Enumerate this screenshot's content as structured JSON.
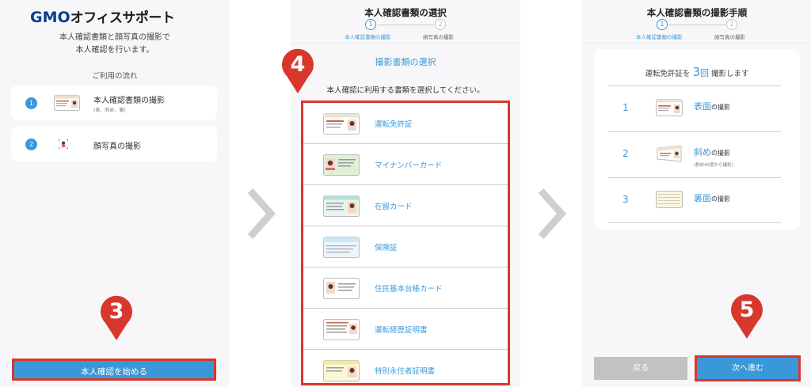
{
  "colors": {
    "accent": "#3a98d8",
    "highlight": "#d8372c",
    "panel_bg": "#f7f7f9",
    "disabled": "#c2c2c2"
  },
  "panel1": {
    "logo_gmo": "GMO",
    "logo_text": "オフィスサポート",
    "intro_line1": "本人確認書類と顔写真の撮影で",
    "intro_line2": "本人確認を行います。",
    "flow_title": "ご利用の流れ",
    "flow": [
      {
        "num": "1",
        "label": "本人確認書類の撮影",
        "sub": "(表、斜め、裏)",
        "icon": "id-card-icon"
      },
      {
        "num": "2",
        "label": "顔写真の撮影",
        "icon": "face-scan-icon"
      }
    ],
    "start_button": "本人確認を始める",
    "marker": "3"
  },
  "panel2": {
    "title": "本人確認書類の選択",
    "steps": [
      {
        "num": "1",
        "label": "本人確認書類の撮影",
        "active": true
      },
      {
        "num": "2",
        "label": "顔写真の撮影",
        "active": false
      }
    ],
    "section_title": "撮影書類の選択",
    "instruction": "本人確認に利用する書類を選択してください。",
    "documents": [
      {
        "label": "運転免許証",
        "icon": "drivers-license-icon"
      },
      {
        "label": "マイナンバーカード",
        "icon": "my-number-card-icon"
      },
      {
        "label": "在留カード",
        "icon": "residence-card-icon"
      },
      {
        "label": "保険証",
        "icon": "insurance-card-icon"
      },
      {
        "label": "住民基本台帳カード",
        "icon": "resident-registry-card-icon"
      },
      {
        "label": "運転経歴証明書",
        "icon": "driving-history-certificate-icon"
      },
      {
        "label": "特別永住者証明書",
        "icon": "special-permanent-resident-icon"
      }
    ],
    "marker": "4"
  },
  "panel3": {
    "title": "本人確認書類の撮影手順",
    "steps": [
      {
        "num": "1",
        "label": "本人確認書類の撮影",
        "active": true
      },
      {
        "num": "2",
        "label": "顔写真の撮影",
        "active": false
      }
    ],
    "count_prefix": "運転免許証を",
    "count_num": "3",
    "count_unit": "回",
    "count_suffix": "撮影します",
    "shots": [
      {
        "num": "1",
        "highlight": "表面",
        "rest": "の撮影",
        "sub": "",
        "icon": "license-front-icon"
      },
      {
        "num": "2",
        "highlight": "斜め",
        "rest": "の撮影",
        "sub": "(斜め45度から撮影)",
        "icon": "license-angled-icon"
      },
      {
        "num": "3",
        "highlight": "裏面",
        "rest": "の撮影",
        "sub": "",
        "icon": "license-back-icon"
      }
    ],
    "back_button": "戻る",
    "next_button": "次へ進む",
    "marker": "5"
  }
}
